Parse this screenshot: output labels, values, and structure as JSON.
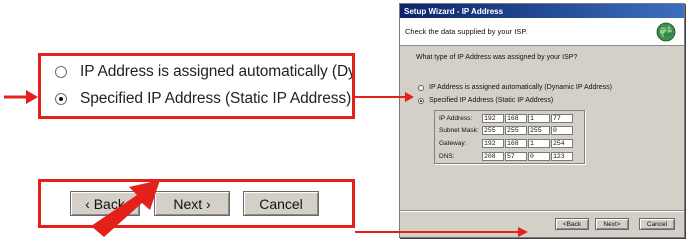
{
  "zoom_radio": {
    "option_auto": "IP Address is assigned automatically (Dynamic IP Address)",
    "option_static": "Specified IP Address (Static IP Address)",
    "selected": "static"
  },
  "zoom_buttons": {
    "back": "‹ Back",
    "next": "Next ›",
    "cancel": "Cancel"
  },
  "dialog": {
    "title": "Setup Wizard - IP Address",
    "header_text": "Check the data supplied by your ISP.",
    "header_icon": "globe-icon",
    "question": "What type of IP Address was assigned by your ISP?",
    "option_auto": "IP Address is assigned automatically (Dynamic IP Address)",
    "option_static": "Specified IP Address (Static IP Address)",
    "fields": [
      {
        "label": "IP Address:",
        "octets": [
          "192",
          "168",
          "1",
          "77"
        ]
      },
      {
        "label": "Subnet Mask:",
        "octets": [
          "255",
          "255",
          "255",
          "0"
        ]
      },
      {
        "label": "Gateway:",
        "octets": [
          "192",
          "168",
          "1",
          "254"
        ]
      },
      {
        "label": "DNS:",
        "octets": [
          "208",
          "57",
          "0",
          "123"
        ]
      }
    ],
    "buttons": {
      "back": "<Back",
      "next": "Next>",
      "cancel": "Cancel"
    }
  },
  "colors": {
    "callout_red": "#e3211a",
    "title_bar": "#0a246a",
    "dialog_face": "#d4d0c8"
  }
}
